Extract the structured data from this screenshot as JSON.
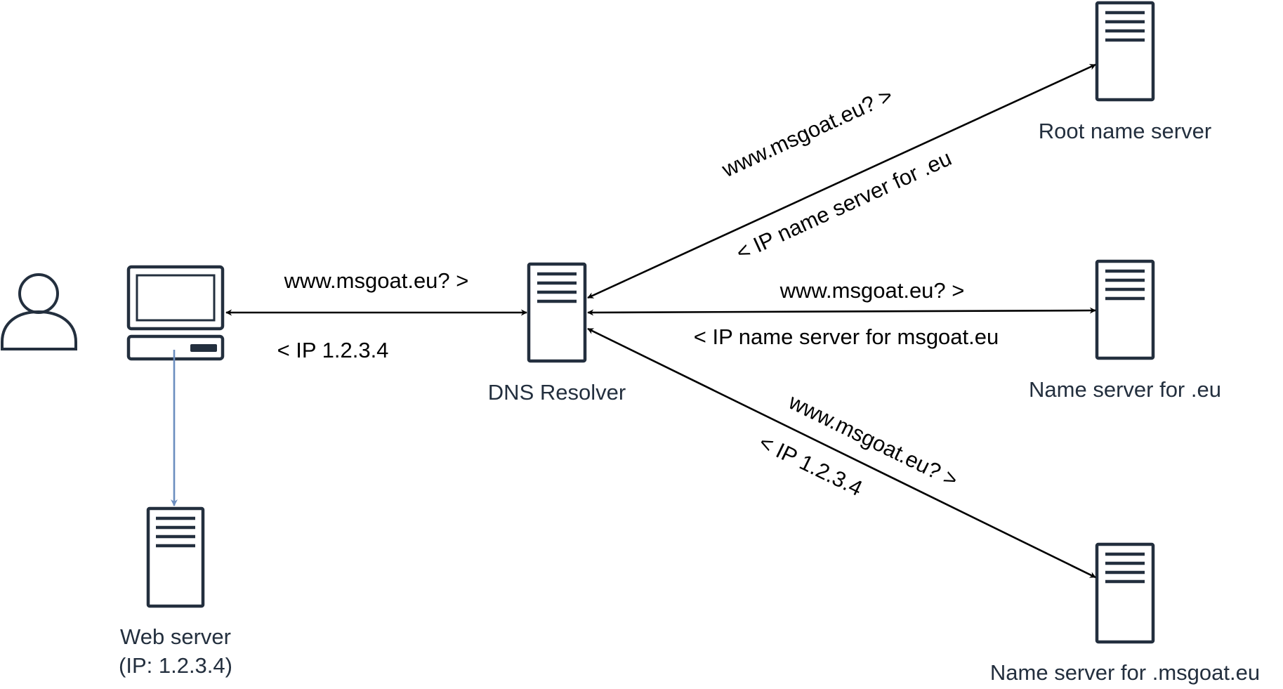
{
  "nodes": {
    "web_server": {
      "label_line1": "Web server",
      "label_line2": "(IP: 1.2.3.4)"
    },
    "dns_resolver": {
      "label": "DNS Resolver"
    },
    "root_server": {
      "label": "Root name server"
    },
    "eu_server": {
      "label": "Name server for .eu"
    },
    "msgoat_server": {
      "label": "Name server for .msgoat.eu"
    }
  },
  "edges": {
    "client_resolver": {
      "query": "www.msgoat.eu? >",
      "reply": "< IP 1.2.3.4"
    },
    "resolver_root": {
      "query": "www.msgoat.eu? >",
      "reply": "< IP name server for .eu"
    },
    "resolver_eu": {
      "query": "www.msgoat.eu? >",
      "reply": "< IP name server for msgoat.eu"
    },
    "resolver_msgoat": {
      "query": "www.msgoat.eu? >",
      "reply": "< IP 1.2.3.4"
    }
  },
  "colors": {
    "icon": "#232f3e",
    "arrow": "#000000",
    "client_to_webserver_arrow": "#6c8ebf"
  },
  "icons": [
    "user-icon",
    "computer-icon",
    "server-icon"
  ]
}
